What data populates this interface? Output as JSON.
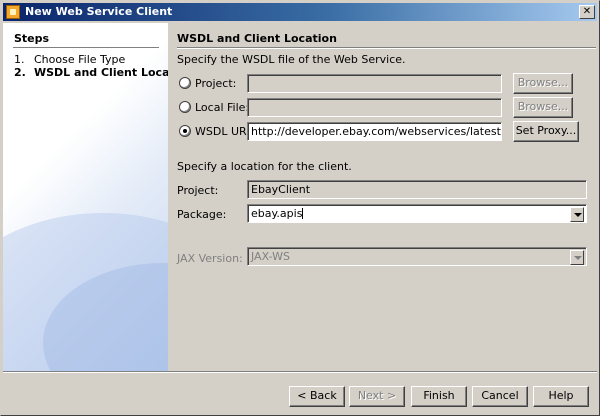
{
  "window": {
    "title": "New Web Service Client",
    "close_glyph": "✕"
  },
  "steps": {
    "heading": "Steps",
    "items": [
      {
        "num": "1.",
        "label": "Choose File Type"
      },
      {
        "num": "2.",
        "label": "WSDL and Client Location"
      }
    ]
  },
  "wsdl": {
    "heading": "WSDL and Client Location",
    "instructions": "Specify the WSDL file of the Web Service.",
    "project_label": "Project:",
    "project_value": "",
    "local_file_label": "Local File:",
    "local_file_value": "",
    "wsdl_url_label": "WSDL URL:",
    "wsdl_url_value": "http://developer.ebay.com/webservices/latest/eBaySvc.wsdl",
    "selected_source": "WSDL URL",
    "browse_label": "Browse...",
    "set_proxy_label": "Set Proxy..."
  },
  "client": {
    "instructions": "Specify a location for the client.",
    "project_label": "Project:",
    "project_value": "EbayClient",
    "package_label": "Package:",
    "package_value": "ebay.apis",
    "jax_label": "JAX Version:",
    "jax_value": "JAX-WS"
  },
  "buttons": {
    "back": "< Back",
    "next": "Next >",
    "finish": "Finish",
    "cancel": "Cancel",
    "help": "Help"
  }
}
